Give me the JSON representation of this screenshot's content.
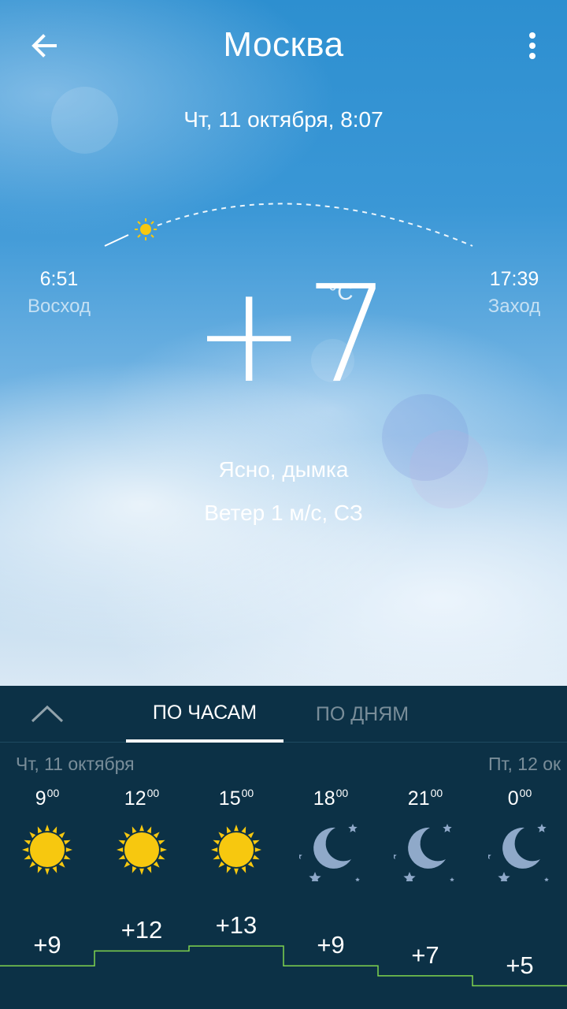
{
  "header": {
    "city": "Москва",
    "datetime": "Чт, 11 октября, 8:07"
  },
  "sun": {
    "sunrise_time": "6:51",
    "sunrise_label": "Восход",
    "sunset_time": "17:39",
    "sunset_label": "Заход"
  },
  "current": {
    "temperature": "+7",
    "unit": "°C",
    "condition": "Ясно, дымка",
    "wind": "Ветер 1 м/с, СЗ"
  },
  "tabs": [
    {
      "label": "ПО ЧАСАМ",
      "active": true
    },
    {
      "label": "ПО ДНЯМ",
      "active": false
    }
  ],
  "forecast": {
    "day1": "Чт, 11 октября",
    "day2": "Пт, 12 ок",
    "hours": [
      {
        "hour": "9",
        "min": "00",
        "icon": "sun-icon",
        "temp": "+9",
        "value": 9
      },
      {
        "hour": "12",
        "min": "00",
        "icon": "sun-icon",
        "temp": "+12",
        "value": 12
      },
      {
        "hour": "15",
        "min": "00",
        "icon": "sun-icon",
        "temp": "+13",
        "value": 13
      },
      {
        "hour": "18",
        "min": "00",
        "icon": "moon-stars-icon",
        "temp": "+9",
        "value": 9
      },
      {
        "hour": "21",
        "min": "00",
        "icon": "moon-stars-icon",
        "temp": "+7",
        "value": 7
      },
      {
        "hour": "0",
        "min": "00",
        "icon": "moon-stars-icon",
        "temp": "+5",
        "value": 5
      }
    ]
  },
  "colors": {
    "sun": "#f7c80f",
    "moon": "#8fa9c9",
    "tempLine": "#7fd34e",
    "panel": "#0c3146"
  }
}
